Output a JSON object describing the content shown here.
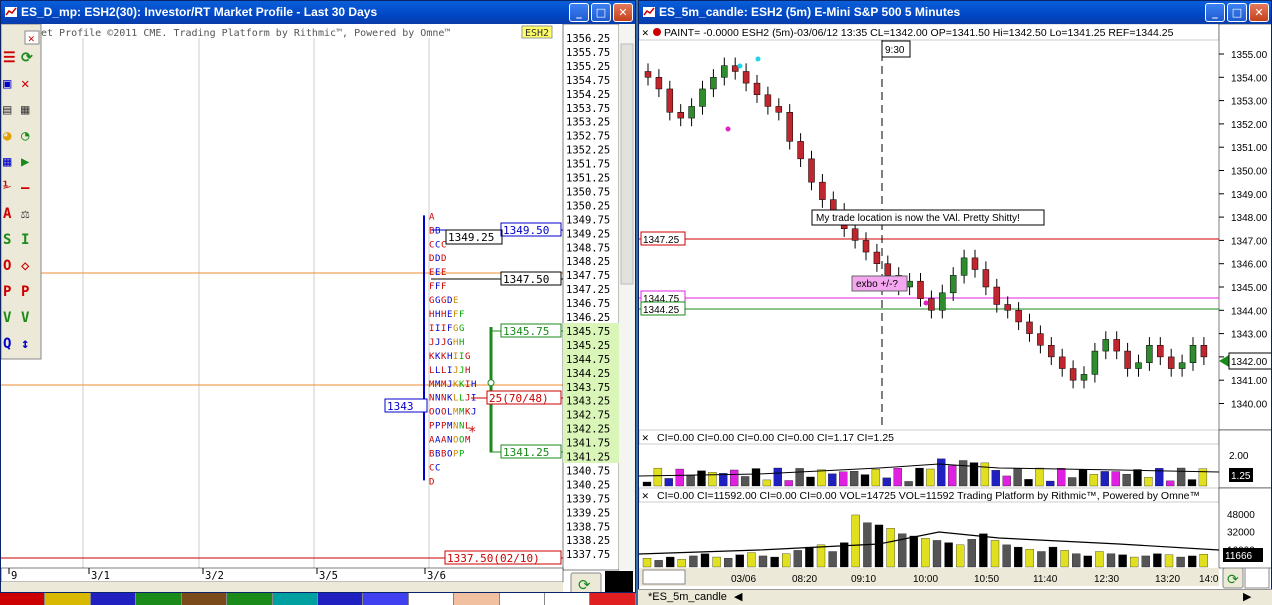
{
  "left_window": {
    "title": "ES_D_mp: ESH2(30): Investor/RT Market Profile - Last 30 Days",
    "subtitle": "et Profile ©2011 CME. Trading Platform by Rithmic™, Powered by Omne™",
    "symbol_badge": "ESH2",
    "price_axis": [
      "1356.25",
      "1355.75",
      "1355.25",
      "1354.75",
      "1354.25",
      "1353.75",
      "1353.25",
      "1352.75",
      "1352.25",
      "1351.75",
      "1351.25",
      "1350.75",
      "1350.25",
      "1349.75",
      "1349.25",
      "1348.75",
      "1348.25",
      "1347.75",
      "1347.25",
      "1346.75",
      "1346.25",
      "1345.75",
      "1345.25",
      "1344.75",
      "1344.25",
      "1343.75",
      "1343.25",
      "1342.75",
      "1342.25",
      "1341.75",
      "1341.25",
      "1340.75",
      "1340.25",
      "1339.75",
      "1339.25",
      "1338.75",
      "1338.25",
      "1337.75"
    ],
    "labels": {
      "high_box": "1349.50",
      "high_inner": "1349.25",
      "level_1347": "1347.50",
      "vah": "1345.75",
      "poc_blue": "1343",
      "poc_red": "25(70/48)",
      "val": "1341.25",
      "bottom": "1337.50(02/10)"
    },
    "date_axis": [
      "9",
      "3/1",
      "3/2",
      "3/5",
      "3/6"
    ],
    "toolbar_icons": [
      "list-icon",
      "refresh-icon",
      "cbm-icon",
      "xyz-icon",
      "calc-icon",
      "doc-icon",
      "pie-icon",
      "pie-green-icon",
      "grid-icon",
      "play-icon",
      "vs-icon",
      "line-icon",
      "font-icon",
      "scale-icon",
      "sp-icon",
      "ib-icon",
      "or-icon",
      "diamond-icon",
      "poc-icon",
      "pocv-icon",
      "va-icon",
      "vavo-icon",
      "q-icon",
      "arrows-icon"
    ]
  },
  "right_window": {
    "title": "ES_5m_candle: ESH2 (5m) E-Mini S&P 500 5 Minutes",
    "info_line": "PAINT= -0.0000   ESH2 (5m)-03/06/12 13:35 CL=1342.00 OP=1341.50 Hi=1342.50 Lo=1341.25   REF=1344.25",
    "time_marker": "9:30",
    "annotation": "My trade location is now the VAl. Pretty Shitty!",
    "exbo_label": "exbo +/-?",
    "levels": {
      "l1": "1347.25",
      "l2": "1344.75",
      "l3": "1344.25"
    },
    "price_axis": [
      "1355.00",
      "1354.00",
      "1353.00",
      "1352.00",
      "1351.00",
      "1350.00",
      "1349.00",
      "1348.00",
      "1347.00",
      "1346.00",
      "1345.00",
      "1344.00",
      "1343.00",
      "1342.00",
      "1341.00",
      "1340.00"
    ],
    "last_price": "1342.00",
    "ci_line": "CI=0.00   CI=0.00   CI=0.00   CI=0.00   CI=1.17   CI=1.25",
    "ci_axis": "2.00",
    "ci_last": "1.25",
    "vol_line": "CI=0.00   CI=11592.00   CI=0.00   CI=0.00   VOL=14725   VOL=11592  Trading Platform by Rithmic™, Powered by Omne™",
    "vol_axis": [
      "48000",
      "32000",
      "16000"
    ],
    "vol_last": "11666",
    "time_axis": [
      "03/06",
      "08:20",
      "09:10",
      "10:00",
      "10:50",
      "11:40",
      "12:30",
      "13:20",
      "14:0"
    ],
    "tab_label": "*ES_5m_candle"
  },
  "colors": {
    "title_blue": "#0047c6",
    "candle_up": "#2e8b2e",
    "candle_down": "#c0262d",
    "value_area": "#d9f5b8"
  },
  "chart_data": [
    {
      "type": "candlestick",
      "title": "ESH2 (5m)",
      "ylim": [
        1339.5,
        1355.5
      ],
      "x": [
        "03/06",
        "08:20",
        "09:10",
        "10:00",
        "10:50",
        "11:40",
        "12:30",
        "13:20",
        "14:0"
      ],
      "series": [
        {
          "name": "ESH2 (5m)",
          "values": [
            1354.0,
            1353.5,
            1352.5,
            1352.25,
            1352.75,
            1353.5,
            1354.0,
            1354.5,
            1354.25,
            1353.75,
            1353.25,
            1352.75,
            1352.5,
            1351.25,
            1350.5,
            1349.5,
            1348.75,
            1348.25,
            1347.5,
            1347.0,
            1346.5,
            1346.0,
            1345.5,
            1345.0,
            1345.25,
            1344.5,
            1344.0,
            1344.75,
            1345.5,
            1346.25,
            1345.75,
            1345.0,
            1344.25,
            1344.0,
            1343.5,
            1343.0,
            1342.5,
            1342.0,
            1341.5,
            1341.0,
            1341.25,
            1342.25,
            1342.75,
            1342.25,
            1341.5,
            1341.75,
            1342.5,
            1342.0,
            1341.5,
            1341.75,
            1342.5,
            1342.0
          ]
        }
      ]
    },
    {
      "type": "bar",
      "title": "VOL",
      "ylim": [
        0,
        56000
      ],
      "series": [
        {
          "name": "VOL",
          "values": [
            8000,
            6000,
            9000,
            7000,
            10000,
            12000,
            9000,
            8000,
            11000,
            13000,
            10000,
            9000,
            12000,
            15000,
            18000,
            20000,
            14000,
            22000,
            47000,
            40000,
            38000,
            35000,
            30000,
            28000,
            26000,
            24000,
            22000,
            20000,
            25000,
            30000,
            24000,
            20000,
            18000,
            16000,
            14000,
            18000,
            15000,
            12000,
            10000,
            14000,
            12000,
            11000,
            9000,
            10000,
            12000,
            11000,
            9000,
            10000,
            11592
          ]
        }
      ]
    }
  ]
}
